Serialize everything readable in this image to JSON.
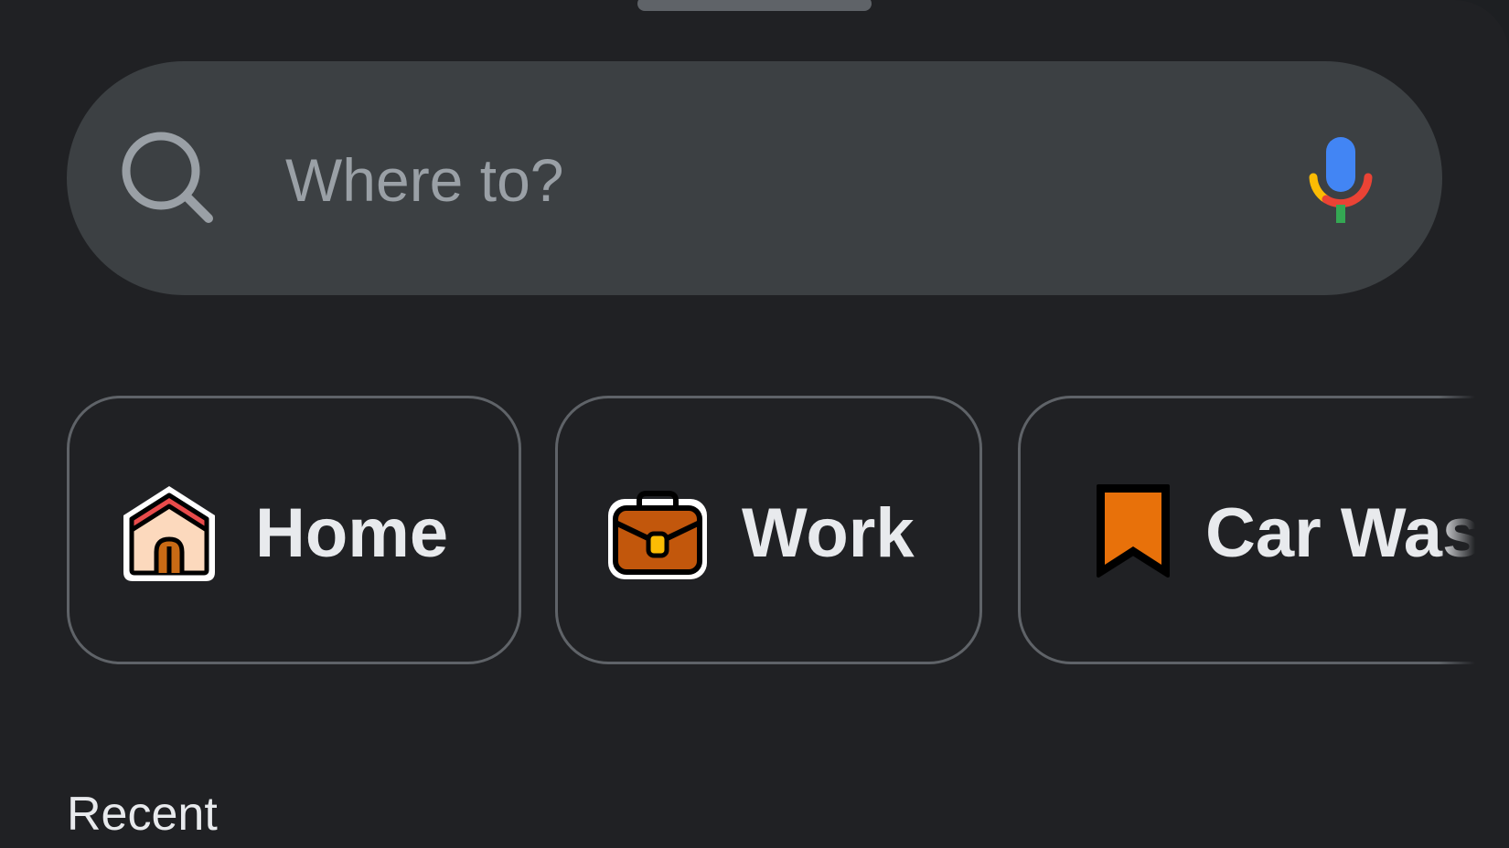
{
  "search": {
    "placeholder": "Where to?",
    "leading_icon": "search-icon",
    "trailing_icon": "microphone-icon"
  },
  "shortcuts": [
    {
      "label": "Home",
      "icon": "home-icon"
    },
    {
      "label": "Work",
      "icon": "briefcase-icon"
    },
    {
      "label": "Car Was",
      "icon": "bookmark-icon"
    }
  ],
  "recent": {
    "title": "Recent"
  },
  "colors": {
    "background": "#202124",
    "search_fill": "#3c4043",
    "chip_border": "#5f6368",
    "text_primary": "#e8eaed",
    "text_hint": "#9aa0a6",
    "mic_blue": "#4285f4",
    "mic_red": "#ea4335",
    "mic_yellow": "#fbbc04",
    "mic_green": "#34a853",
    "bookmark_orange": "#e8710a"
  }
}
